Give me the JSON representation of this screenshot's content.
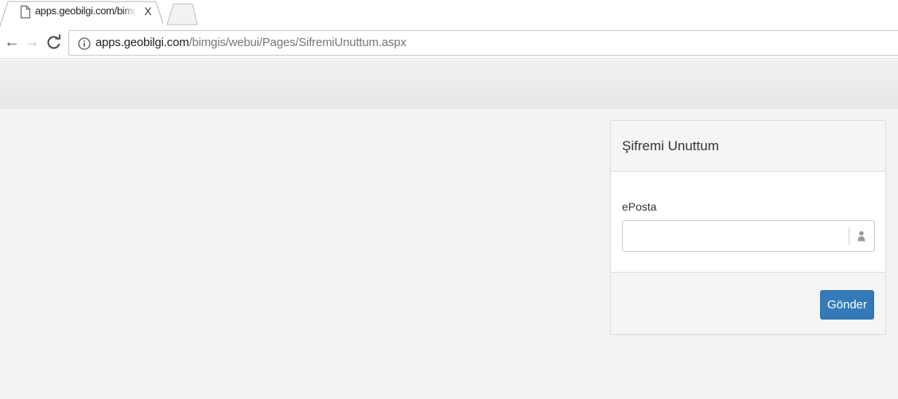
{
  "browser": {
    "tab": {
      "title": "apps.geobilgi.com/bimgi",
      "close_glyph": "X",
      "icon": "page-icon"
    },
    "nav": {
      "back_glyph": "←",
      "forward_glyph": "→",
      "reload_glyph": "C"
    },
    "address": {
      "host": "apps.geobilgi.com",
      "path": "/bimgis/webui/Pages/SifremiUnuttum.aspx",
      "security_icon": "info-icon"
    }
  },
  "panel": {
    "title": "Şifremi Unuttum",
    "email_label": "ePosta",
    "email_value": "",
    "email_icon": "user-icon",
    "submit_label": "Gönder"
  },
  "colors": {
    "primary_button": "#337ab7",
    "page_background": "#f3f3f3",
    "header_band": "#ebebeb"
  }
}
